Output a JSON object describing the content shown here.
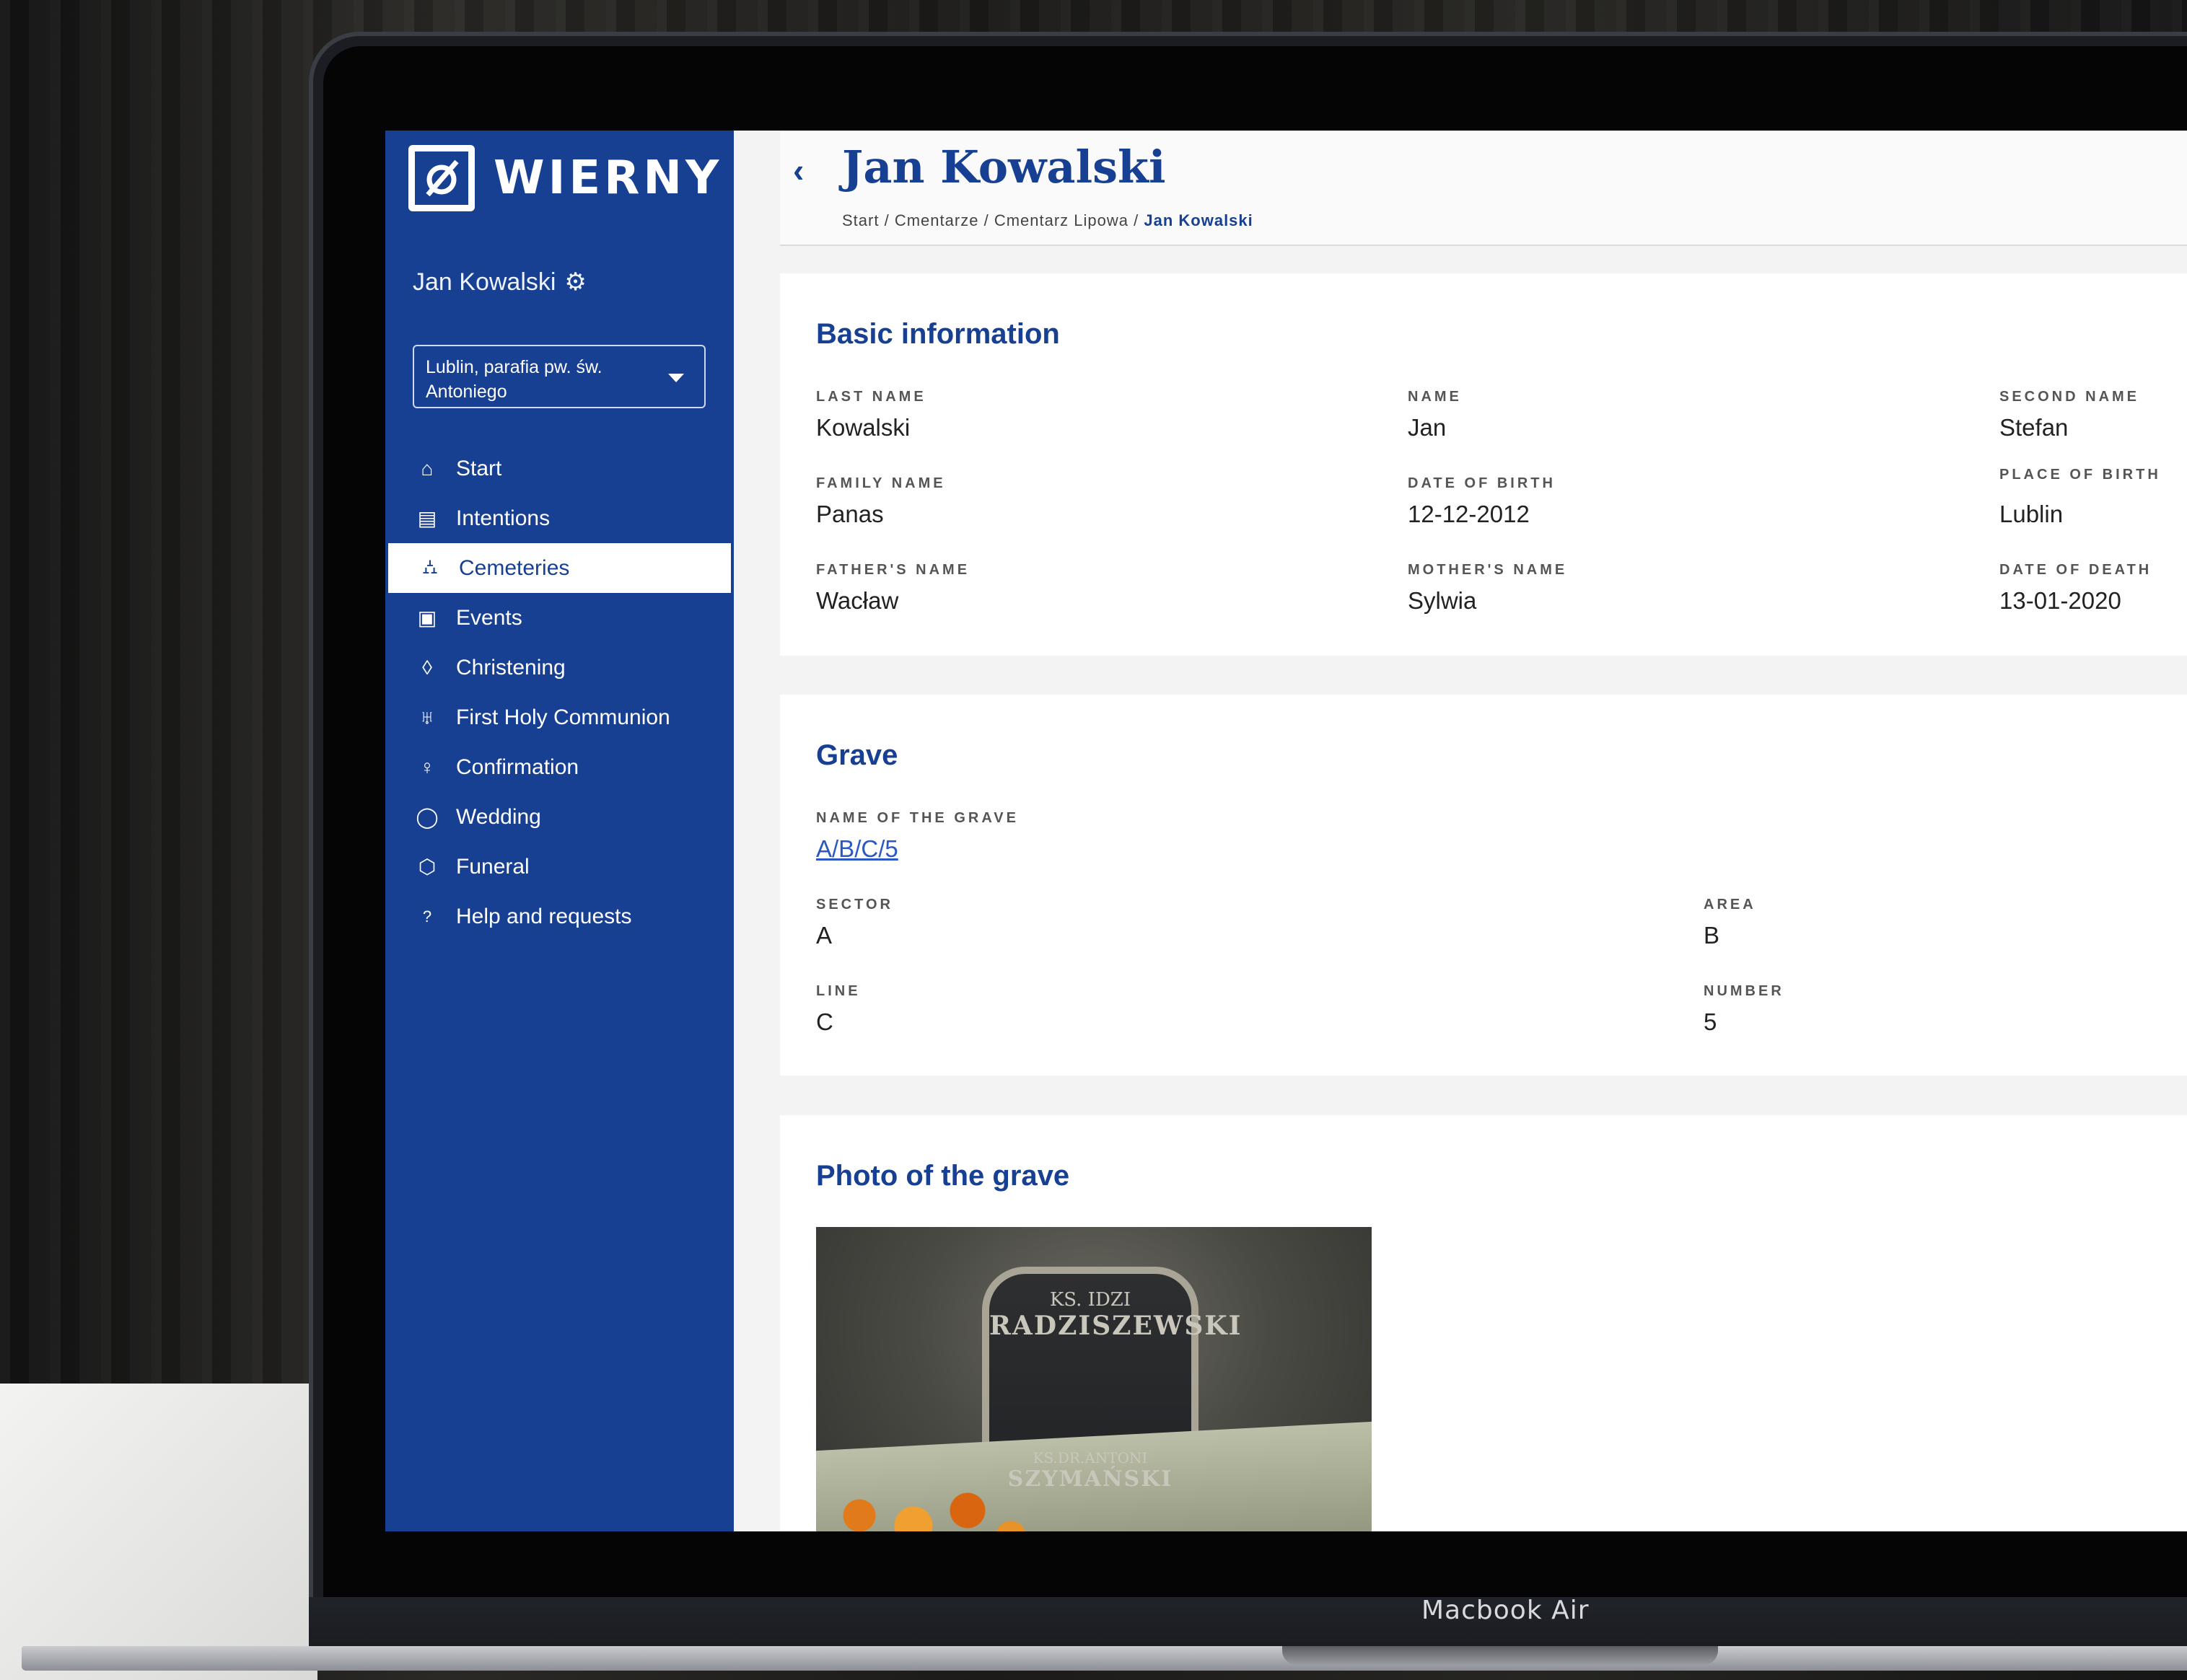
{
  "device_label": "Macbook Air",
  "app": {
    "logo_text": "WIERNY",
    "user_name": "Jan Kowalski",
    "parish_select": "Lublin, parafia pw. św. Antoniego"
  },
  "nav": {
    "start": "Start",
    "intentions": "Intentions",
    "cemeteries": "Cemeteries",
    "events": "Events",
    "christening": "Christening",
    "communion": "First Holy Communion",
    "confirmation": "Confirmation",
    "wedding": "Wedding",
    "funeral": "Funeral",
    "help": "Help and requests"
  },
  "header": {
    "title": "Jan Kowalski",
    "breadcrumb": {
      "start": "Start",
      "cemeteries": "Cmentarze",
      "cemetery": "Cmentarz Lipowa",
      "current": "Jan Kowalski",
      "sep": "/"
    }
  },
  "basic": {
    "title": "Basic information",
    "last_name_label": "LAST NAME",
    "last_name": "Kowalski",
    "name_label": "NAME",
    "name": "Jan",
    "second_name_label": "SECOND NAME",
    "second_name": "Stefan",
    "family_name_label": "FAMILY NAME",
    "family_name": "Panas",
    "dob_label": "DATE OF BIRTH",
    "dob": "12-12-2012",
    "pob_label": "PLACE OF BIRTH",
    "pob": "Lublin",
    "father_label": "FATHER'S NAME",
    "father": "Wacław",
    "mother_label": "MOTHER'S NAME",
    "mother": "Sylwia",
    "dod_label": "DATE OF DEATH",
    "dod": "13-01-2020"
  },
  "grave": {
    "title": "Grave",
    "name_label": "NAME OF THE GRAVE",
    "name": "A/B/C/5",
    "sector_label": "SECTOR",
    "sector": "A",
    "area_label": "AREA",
    "area": "B",
    "line_label": "LINE",
    "line": "C",
    "number_label": "NUMBER",
    "number": "5"
  },
  "photo": {
    "title": "Photo of the grave",
    "stone_line1": "KS. IDZI",
    "stone_line2": "RADZISZEWSKI",
    "stone_line3": "KS.DR.ANTONI",
    "stone_line4": "SZYMAŃSKI"
  },
  "colors": {
    "brand": "#173f92",
    "link": "#2b59c3"
  }
}
